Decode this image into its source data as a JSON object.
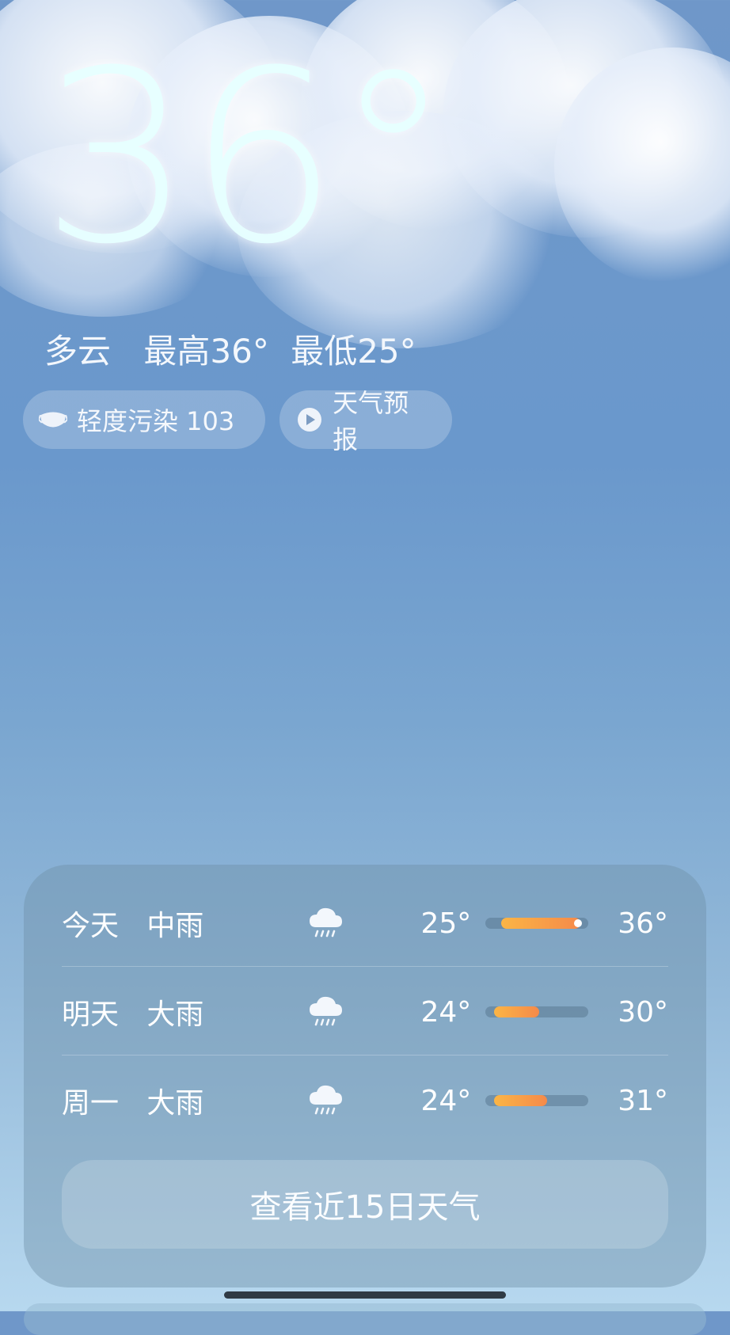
{
  "current": {
    "temperature": "36°",
    "condition": "多云",
    "high": "最高36°",
    "low": "最低25°"
  },
  "chips": {
    "aqi_label": "轻度污染 103",
    "forecast_label": "天气预报"
  },
  "forecast": [
    {
      "day": "今天",
      "condition": "中雨",
      "icon": "rain-cloud-icon",
      "low": "25°",
      "high": "36°",
      "range_start": 0.15,
      "range_end": 0.92,
      "current_marker": true
    },
    {
      "day": "明天",
      "condition": "大雨",
      "icon": "rain-cloud-icon",
      "low": "24°",
      "high": "30°",
      "range_start": 0.08,
      "range_end": 0.52,
      "current_marker": false
    },
    {
      "day": "周一",
      "condition": "大雨",
      "icon": "rain-cloud-icon",
      "low": "24°",
      "high": "31°",
      "range_start": 0.08,
      "range_end": 0.6,
      "current_marker": false
    }
  ],
  "cta_label": "查看近15日天气",
  "colors": {
    "sky_top": "#6f97c9",
    "sky_bottom": "#b7d8ef",
    "bar_start": "#fbb545",
    "bar_end": "#f58a4a"
  }
}
